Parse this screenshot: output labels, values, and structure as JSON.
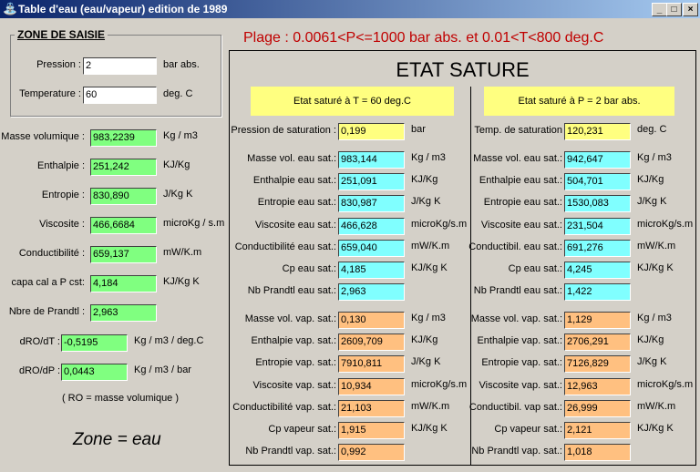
{
  "window": {
    "title": "Table d'eau  (eau/vapeur) edition de 1989",
    "minimize": "_",
    "maximize": "□",
    "close": "×"
  },
  "range_text": "Plage : 0.0061<P<=1000 bar abs. et 0.01<T<800 deg.C",
  "input_zone": {
    "title": "ZONE DE SAISIE",
    "pression": {
      "label": "Pression :",
      "value": "2",
      "unit": "bar abs."
    },
    "temperature": {
      "label": "Temperature :",
      "value": "60",
      "unit": "deg. C"
    }
  },
  "left_results": [
    {
      "label": "Masse volumique :",
      "value": "983,2239",
      "unit": "Kg / m3"
    },
    {
      "label": "Enthalpie :",
      "value": "251,242",
      "unit": "KJ/Kg"
    },
    {
      "label": "Entropie :",
      "value": "830,890",
      "unit": "J/Kg K"
    },
    {
      "label": "Viscosite :",
      "value": "466,6684",
      "unit": "microKg / s.m"
    },
    {
      "label": "Conductibilité :",
      "value": "659,137",
      "unit": "mW/K.m"
    },
    {
      "label": "capa cal a P cst:",
      "value": "4,184",
      "unit": "KJ/Kg K"
    },
    {
      "label": "Nbre de Prandtl :",
      "value": "2,963",
      "unit": ""
    }
  ],
  "derivatives": [
    {
      "label": "dRO/dT :",
      "value": "-0,5195",
      "unit": "Kg / m3 / deg.C"
    },
    {
      "label": "dRO/dP :",
      "value": "0,0443",
      "unit": "Kg / m3 / bar"
    }
  ],
  "ro_note": "( RO = masse volumique )",
  "zone_text": "Zone = eau",
  "saturated": {
    "title": "ETAT SATURE",
    "by_T": {
      "header": "Etat saturé à  T = 60       deg.C",
      "sat": {
        "label": "Pression de saturation :",
        "value": "0,199",
        "unit": "bar"
      },
      "water": [
        {
          "label": "Masse vol. eau sat.:",
          "value": "983,144",
          "unit": "Kg / m3"
        },
        {
          "label": "Enthalpie eau sat.:",
          "value": "251,091",
          "unit": "KJ/Kg"
        },
        {
          "label": "Entropie eau sat.:",
          "value": "830,987",
          "unit": "J/Kg K"
        },
        {
          "label": "Viscosite eau sat.:",
          "value": "466,628",
          "unit": "microKg/s.m"
        },
        {
          "label": "Conductibilité eau sat.:",
          "value": "659,040",
          "unit": "mW/K.m"
        },
        {
          "label": "Cp eau sat.:",
          "value": "4,185",
          "unit": "KJ/Kg K"
        },
        {
          "label": "Nb Prandtl eau sat.:",
          "value": "2,963",
          "unit": ""
        }
      ],
      "vapor": [
        {
          "label": "Masse vol. vap. sat.:",
          "value": "0,130",
          "unit": "Kg / m3"
        },
        {
          "label": "Enthalpie vap. sat.:",
          "value": "2609,709",
          "unit": "KJ/Kg"
        },
        {
          "label": "Entropie vap. sat.:",
          "value": "7910,811",
          "unit": "J/Kg K"
        },
        {
          "label": "Viscosite vap. sat.:",
          "value": "10,934",
          "unit": "microKg/s.m"
        },
        {
          "label": "Conductibilité vap. sat.:",
          "value": "21,103",
          "unit": "mW/K.m"
        },
        {
          "label": "Cp vapeur sat.:",
          "value": "1,915",
          "unit": "KJ/Kg K"
        },
        {
          "label": "Nb Prandtl vap. sat.:",
          "value": "0,992",
          "unit": ""
        }
      ]
    },
    "by_P": {
      "header": "Etat saturé à  P =    2         bar abs.",
      "sat": {
        "label": "Temp. de saturation",
        "value": "120,231",
        "unit": "deg. C"
      },
      "water": [
        {
          "label": "Masse vol. eau sat.:",
          "value": "942,647",
          "unit": "Kg / m3"
        },
        {
          "label": "Enthalpie eau sat.:",
          "value": "504,701",
          "unit": "KJ/Kg"
        },
        {
          "label": "Entropie eau sat.:",
          "value": "1530,083",
          "unit": "J/Kg K"
        },
        {
          "label": "Viscosite eau sat.:",
          "value": "231,504",
          "unit": "microKg/s.m"
        },
        {
          "label": "Conductibil. eau sat.:",
          "value": "691,276",
          "unit": "mW/K.m"
        },
        {
          "label": "Cp eau sat.:",
          "value": "4,245",
          "unit": "KJ/Kg K"
        },
        {
          "label": "Nb Prandtl eau sat.:",
          "value": "1,422",
          "unit": ""
        }
      ],
      "vapor": [
        {
          "label": "Masse vol. vap. sat.:",
          "value": "1,129",
          "unit": "Kg / m3"
        },
        {
          "label": "Enthalpie vap. sat.:",
          "value": "2706,291",
          "unit": "KJ/Kg"
        },
        {
          "label": "Entropie vap. sat.:",
          "value": "7126,829",
          "unit": "J/Kg K"
        },
        {
          "label": "Viscosite vap. sat.:",
          "value": "12,963",
          "unit": "microKg/s.m"
        },
        {
          "label": "Conductibil. vap sat.:",
          "value": "26,999",
          "unit": "mW/K.m"
        },
        {
          "label": "Cp vapeur sat.:",
          "value": "2,121",
          "unit": "KJ/Kg K"
        },
        {
          "label": "Nb Prandtl vap. sat.:",
          "value": "1,018",
          "unit": ""
        }
      ]
    }
  },
  "colors": {
    "title_bar": "#0a246a",
    "range_text": "#c00000",
    "water_field": "#80ffff",
    "vapor_field": "#ffc080",
    "sat_field": "#ffff80",
    "result_field": "#80ff80"
  }
}
